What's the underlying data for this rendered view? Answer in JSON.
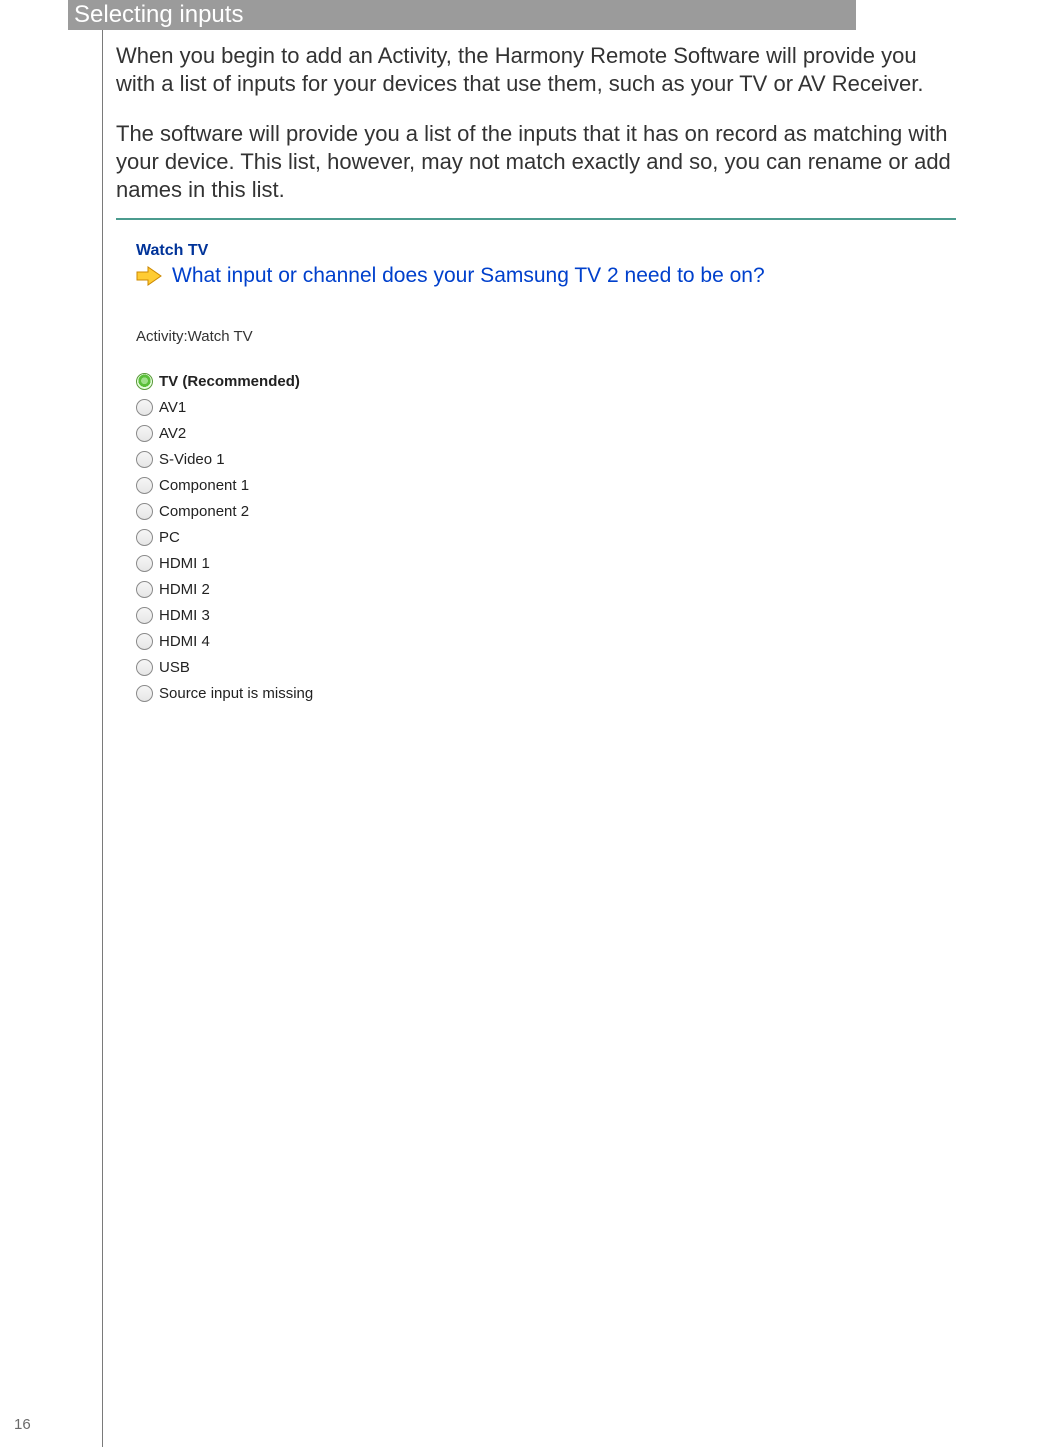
{
  "header": {
    "title": "Selecting inputs"
  },
  "paragraphs": {
    "p1": "When you begin to add an Activity, the Harmony Remote Software will provide you with a list of inputs for your devices that use them, such as your TV or AV Receiver.",
    "p2": "The software will provide you a list of the inputs that it has on record as matching with your device. This list, however, may not match exactly and so, you can rename or add names in this list."
  },
  "screenshot": {
    "watch_label": "Watch TV",
    "question": "What input or channel does your Samsung TV 2 need to be on?",
    "activity_line": "Activity:Watch TV",
    "options": [
      {
        "label": "TV (Recommended)",
        "selected": true,
        "bold": true
      },
      {
        "label": "AV1",
        "selected": false,
        "bold": false
      },
      {
        "label": "AV2",
        "selected": false,
        "bold": false
      },
      {
        "label": "S-Video 1",
        "selected": false,
        "bold": false
      },
      {
        "label": "Component 1",
        "selected": false,
        "bold": false
      },
      {
        "label": "Component 2",
        "selected": false,
        "bold": false
      },
      {
        "label": "PC",
        "selected": false,
        "bold": false
      },
      {
        "label": "HDMI 1",
        "selected": false,
        "bold": false
      },
      {
        "label": "HDMI 2",
        "selected": false,
        "bold": false
      },
      {
        "label": "HDMI 3",
        "selected": false,
        "bold": false
      },
      {
        "label": "HDMI 4",
        "selected": false,
        "bold": false
      },
      {
        "label": "USB",
        "selected": false,
        "bold": false
      },
      {
        "label": "Source input is missing",
        "selected": false,
        "bold": false
      }
    ]
  },
  "page_number": "16"
}
